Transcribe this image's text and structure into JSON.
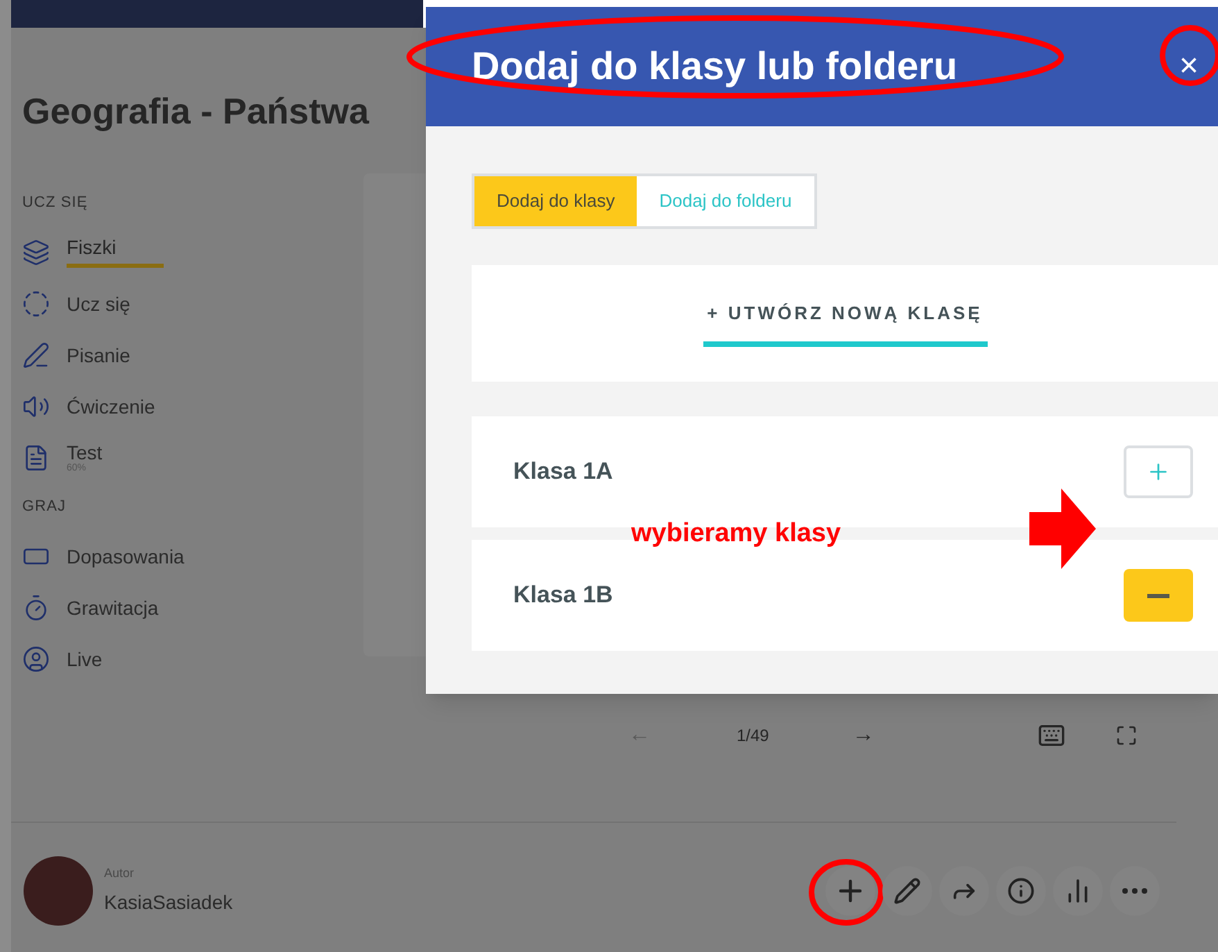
{
  "page": {
    "title": "Geografia - Państwa"
  },
  "sidebar": {
    "sections": [
      {
        "heading": "UCZ SIĘ",
        "items": [
          {
            "label": "Fiszki",
            "selected": true
          },
          {
            "label": "Ucz się",
            "selected": false
          },
          {
            "label": "Pisanie",
            "selected": false
          },
          {
            "label": "Ćwiczenie",
            "selected": false
          },
          {
            "label": "Test",
            "selected": false,
            "sublabel": "60%"
          }
        ]
      },
      {
        "heading": "GRAJ",
        "items": [
          {
            "label": "Dopasowania",
            "selected": false
          },
          {
            "label": "Grawitacja",
            "selected": false
          },
          {
            "label": "Live",
            "selected": false
          }
        ]
      }
    ]
  },
  "pager": {
    "prev": "←",
    "position": "1/49",
    "next": "→"
  },
  "author": {
    "caption": "Autor",
    "name": "KasiaSasiadek"
  },
  "modal": {
    "title": "Dodaj do klasy lub folderu",
    "close": "×",
    "tabs": [
      {
        "label": "Dodaj do klasy",
        "selected": true
      },
      {
        "label": "Dodaj do folderu",
        "selected": false
      }
    ],
    "create_class": "+ UTWÓRZ NOWĄ KLASĘ",
    "classes": [
      {
        "name": "Klasa 1A",
        "added": false
      },
      {
        "name": "Klasa 1B",
        "added": true
      }
    ]
  },
  "annotation": {
    "text": "wybieramy klasy"
  }
}
